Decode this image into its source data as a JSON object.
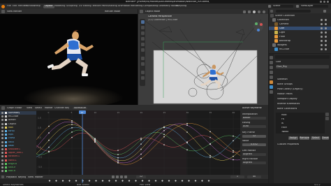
{
  "app": {
    "window_title": "Blender* [/home/rik/movies/Documents/animation/walkcloe_run.blend]",
    "menus": [
      "File",
      "Edit",
      "Render",
      "Window",
      "Help"
    ],
    "workspace_tabs": [
      "Layout",
      "Modeling",
      "Sculpting",
      "UV Editing",
      "Texture Paint",
      "Shading",
      "Animation",
      "Rendering",
      "Compositing",
      "Geometry Nodes",
      "Scripting"
    ],
    "active_tab_index": 0,
    "scene_label": "Scene",
    "view_layer_label": "ViewLayer"
  },
  "render_view": {
    "header_label": "View Render",
    "overlay_label": "Render Mode"
  },
  "camera_view": {
    "header_label": "Object Mode",
    "camera_title": "Camera Perspective",
    "camera_subtitle": "(12) Collection | RIG-cloe"
  },
  "outliner": {
    "rows": [
      {
        "label": "Scene Collection",
        "selected": false
      },
      {
        "label": "Collection",
        "selected": false
      },
      {
        "label": "Camera",
        "selected": false
      },
      {
        "label": "Cloe",
        "selected": true
      },
      {
        "label": "Light",
        "selected": false
      },
      {
        "label": "Floor",
        "selected": false
      },
      {
        "label": "Backdrop",
        "selected": false
      },
      {
        "label": "Widgets",
        "selected": false
      },
      {
        "label": "RIG-cloe",
        "selected": false
      }
    ]
  },
  "properties": {
    "object_name": "Cloe",
    "data_name": "Cloe_Rig",
    "sections": [
      "Skeleton",
      "Bone Groups",
      "Pose Library (Legacy)",
      "Motion Paths",
      "Viewport Display",
      "Inverse Kinematics",
      "Bone Collections",
      "Custom Properties"
    ],
    "bone_groups": [
      "Root",
      "FK",
      "IK",
      "Face",
      "Tweak"
    ],
    "buttons": [
      "Assign",
      "Remove",
      "Select",
      "Deselect"
    ]
  },
  "graph_editor": {
    "header_items": [
      "View",
      "Select",
      "Marker",
      "Channel",
      "Key"
    ],
    "mode_label": "Graph Editor",
    "frame_label": "Normalize",
    "current_frame": "12",
    "channels": [
      {
        "label": "Summary",
        "color": "#f0f0f0"
      },
      {
        "label": "RIG-cloe",
        "color": "#cfcfcf"
      },
      {
        "label": "Action",
        "color": "#cfcfcf"
      },
      {
        "label": "Object",
        "color": "#cfcfcf"
      },
      {
        "label": "root",
        "color": "#e7d15b"
      },
      {
        "label": "torso",
        "color": "#5fb2e8"
      },
      {
        "label": "hips",
        "color": "#5fb2e8"
      },
      {
        "label": "chest",
        "color": "#5fb2e8"
      },
      {
        "label": "neck",
        "color": "#5fb2e8"
      },
      {
        "label": "head",
        "color": "#5fb2e8"
      },
      {
        "label": "shoulder.L",
        "color": "#e05858"
      },
      {
        "label": "upper_arm.L",
        "color": "#e05858"
      },
      {
        "label": "forearm.L",
        "color": "#e05858"
      },
      {
        "label": "hand.L",
        "color": "#e05858"
      },
      {
        "label": "thigh.R",
        "color": "#5cc661"
      },
      {
        "label": "shin.R",
        "color": "#5cc661"
      },
      {
        "label": "foot.R",
        "color": "#5cc661"
      }
    ],
    "y_ticks": [
      "1.5",
      "1.0",
      "0.5",
      "0.0",
      "-0.5",
      "-1.0"
    ],
    "x_ticks": [
      "0",
      "5",
      "10",
      "15",
      "20",
      "25",
      "30",
      "35",
      "40"
    ]
  },
  "sidebar_panel": {
    "title": "Active Keyframe",
    "fields": [
      "Interpolation",
      "Easing",
      "Key Frame",
      "Value",
      "Left Handle",
      "Right Handle"
    ],
    "values": [
      "Bezier",
      "Auto",
      "12",
      "0.452",
      "Aligned",
      "Aligned"
    ]
  },
  "dope_sheet": {
    "header_items": [
      "Playback",
      "Keying",
      "View",
      "Marker"
    ],
    "frame_start": "1",
    "frame_end": "40",
    "current_frame": "12"
  },
  "status_bar": {
    "left": "Select Keyframes",
    "middle": "Box Select",
    "right": "Pan View",
    "version": "4.0.2"
  }
}
